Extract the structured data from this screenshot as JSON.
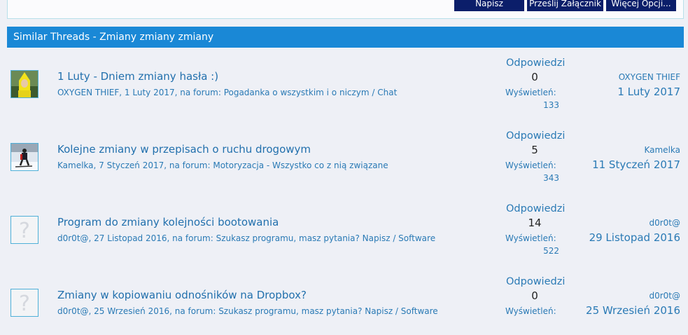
{
  "toolbar": {
    "reply_label": "Napisz",
    "attach_label": "Prześlij Załącznik",
    "more_label": "Więcej Opcji..."
  },
  "similar": {
    "header": "Similar Threads - Zmiany zmiany zmiany",
    "replies_label": "Odpowiedzi",
    "views_label": "Wyświetleń:",
    "threads": [
      {
        "title": "1 Luty - Dniem zmiany hasła :)",
        "author": "OXYGEN THIEF",
        "date": "1 Luty 2017",
        "forum_prefix": ", na forum: ",
        "forum": "Pogadanka o wszystkim i o niczym / Chat",
        "replies": "0",
        "views": "133",
        "last_user": "OXYGEN THIEF",
        "last_date": "1 Luty 2017",
        "avatar": "yellow-costume-avatar"
      },
      {
        "title": "Kolejne zmiany w przepisach o ruchu drogowym",
        "author": "Kamelka",
        "date": "7 Styczeń 2017",
        "forum_prefix": ", na forum: ",
        "forum": "Motoryzacja - Wszystko co z nią związane",
        "replies": "5",
        "views": "343",
        "last_user": "Kamelka",
        "last_date": "11 Styczeń 2017",
        "avatar": "skier-avatar"
      },
      {
        "title": "Program do zmiany kolejności bootowania",
        "author": "d0r0t@",
        "date": "27 Listopad 2016",
        "forum_prefix": ", na forum: ",
        "forum": "Szukasz programu, masz pytania? Napisz / Software",
        "replies": "14",
        "views": "522",
        "last_user": "d0r0t@",
        "last_date": "29 Listopad 2016",
        "avatar": "default-avatar"
      },
      {
        "title": "Zmiany w kopiowaniu odnośników na Dropbox?",
        "author": "d0r0t@",
        "date": "25 Wrzesień 2016",
        "forum_prefix": ", na forum: ",
        "forum": "Szukasz programu, masz pytania? Napisz / Software",
        "replies": "0",
        "views": "",
        "last_user": "d0r0t@",
        "last_date": "25 Wrzesień 2016",
        "avatar": "default-avatar"
      }
    ]
  }
}
